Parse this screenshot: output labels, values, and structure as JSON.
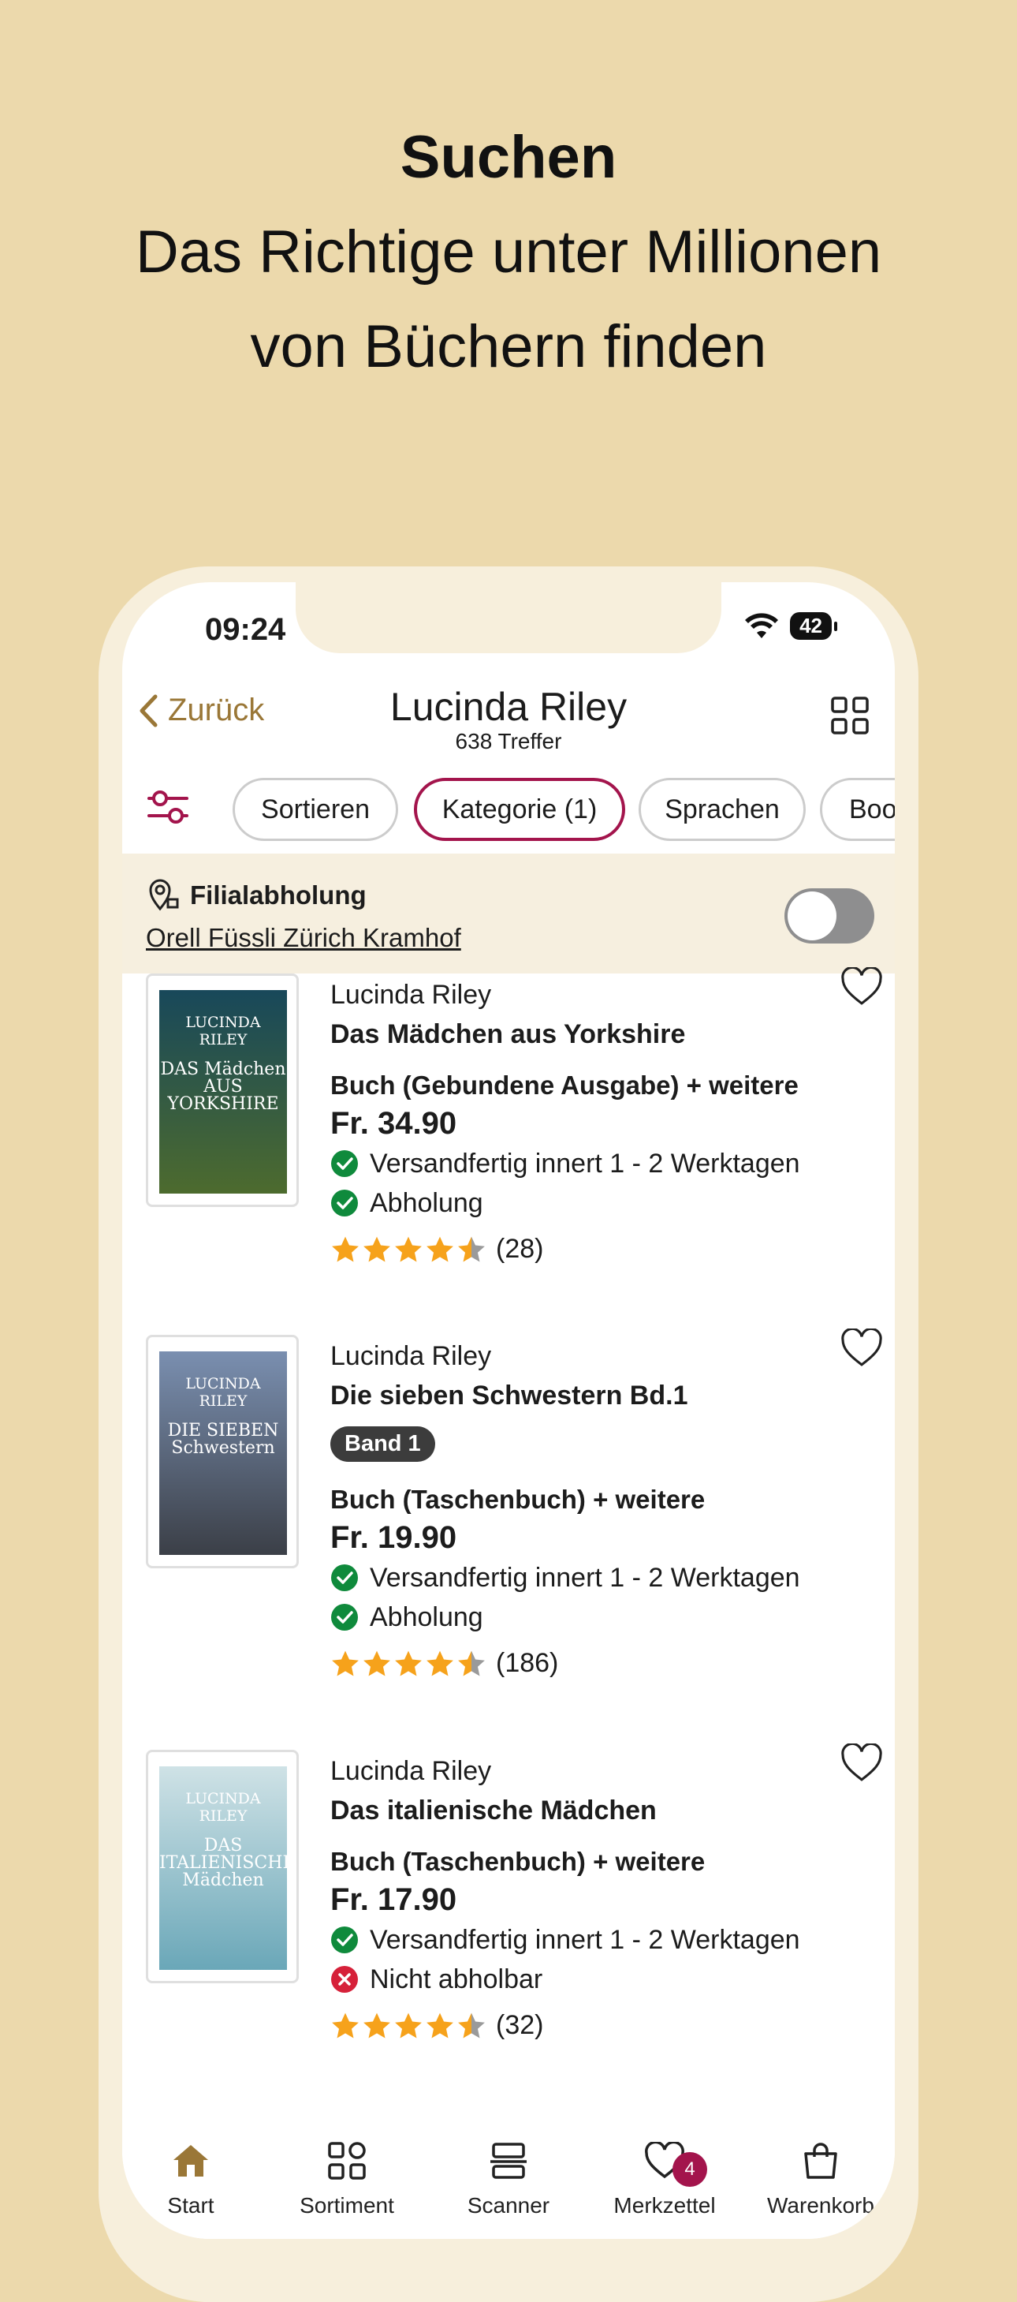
{
  "promo": {
    "title": "Suchen",
    "line1": "Das Richtige unter Millionen",
    "line2": "von Büchern finden"
  },
  "status": {
    "time": "09:24",
    "battery": "42"
  },
  "nav": {
    "back_label": "Zurück",
    "title": "Lucinda Riley",
    "count": "638 Treffer"
  },
  "chips": [
    "Sortieren",
    "Kategorie (1)",
    "Sprachen",
    "Boo"
  ],
  "pickup": {
    "label": "Filialabholung",
    "store": "Orell Füssli Zürich Kramhof",
    "enabled": false
  },
  "results": [
    {
      "author": "Lucinda Riley",
      "title": "Das Mädchen aus Yorkshire",
      "band": "",
      "format": "Buch (Gebundene Ausgabe) + weitere",
      "price": "Fr. 34.90",
      "shipping": "Versandfertig innert 1 - 2 Werktagen",
      "shipping_ok": true,
      "pickup": "Abholung",
      "pickup_ok": true,
      "rating": 4.5,
      "reviews": "(28)",
      "cover": {
        "author": "LUCINDA RILEY",
        "title": "DAS Mädchen AUS YORKSHIRE",
        "color_top": "#18485a",
        "color_bottom": "#4d6b2e"
      }
    },
    {
      "author": "Lucinda Riley",
      "title": "Die sieben Schwestern Bd.1",
      "band": "Band 1",
      "format": "Buch (Taschenbuch) + weitere",
      "price": "Fr. 19.90",
      "shipping": "Versandfertig innert 1 - 2 Werktagen",
      "shipping_ok": true,
      "pickup": "Abholung",
      "pickup_ok": true,
      "rating": 4.5,
      "reviews": "(186)",
      "cover": {
        "author": "LUCINDA RILEY",
        "title": "DIE SIEBEN Schwestern",
        "color_top": "#7a8fb0",
        "color_bottom": "#3b3f47"
      }
    },
    {
      "author": "Lucinda Riley",
      "title": "Das italienische Mädchen",
      "band": "",
      "format": "Buch (Taschenbuch) + weitere",
      "price": "Fr. 17.90",
      "shipping": "Versandfertig innert 1 - 2 Werktagen",
      "shipping_ok": true,
      "pickup": "Nicht abholbar",
      "pickup_ok": false,
      "rating": 4.5,
      "reviews": "(32)",
      "cover": {
        "author": "LUCINDA RILEY",
        "title": "DAS ITALIENISCHE Mädchen",
        "color_top": "#cfe2e6",
        "color_bottom": "#6aa7b8"
      }
    }
  ],
  "tabs": [
    {
      "label": "Start",
      "icon": "home-icon",
      "active": true
    },
    {
      "label": "Sortiment",
      "icon": "grid-icon"
    },
    {
      "label": "Scanner",
      "icon": "scanner-icon"
    },
    {
      "label": "Merkzettel",
      "icon": "heart-icon",
      "badge": "4"
    },
    {
      "label": "Warenkorb",
      "icon": "bag-icon"
    }
  ],
  "colors": {
    "background": "#ecd9ac",
    "accent": "#a3144c",
    "back_link": "#9a7737",
    "star": "#f6a21b",
    "check": "#0f8a3c",
    "cross": "#d6213a"
  }
}
